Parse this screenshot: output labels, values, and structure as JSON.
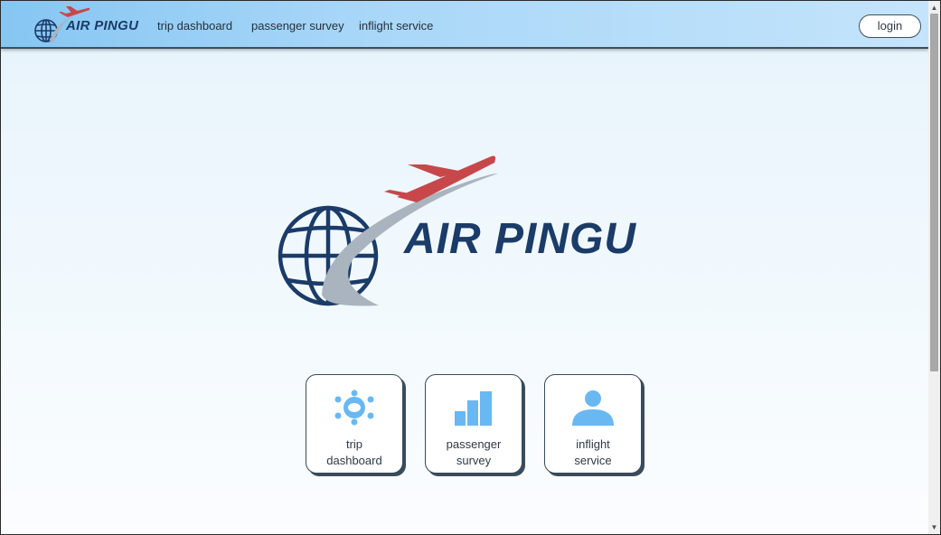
{
  "brand": {
    "name": "AIR PINGU"
  },
  "nav": {
    "links": [
      "trip dashboard",
      "passenger survey",
      "inflight service"
    ],
    "login": "login"
  },
  "hero": {
    "logo_text": "AIR PINGU"
  },
  "cards": [
    {
      "line1": "trip",
      "line2": "dashboard",
      "icon": "network-icon"
    },
    {
      "line1": "passenger",
      "line2": "survey",
      "icon": "bar-chart-icon"
    },
    {
      "line1": "inflight",
      "line2": "service",
      "icon": "person-icon"
    }
  ],
  "colors": {
    "navy": "#1b3b68",
    "plane_red": "#c8474a",
    "icon_blue": "#6ab8f2",
    "swoosh_grey": "#a9b4bf"
  }
}
